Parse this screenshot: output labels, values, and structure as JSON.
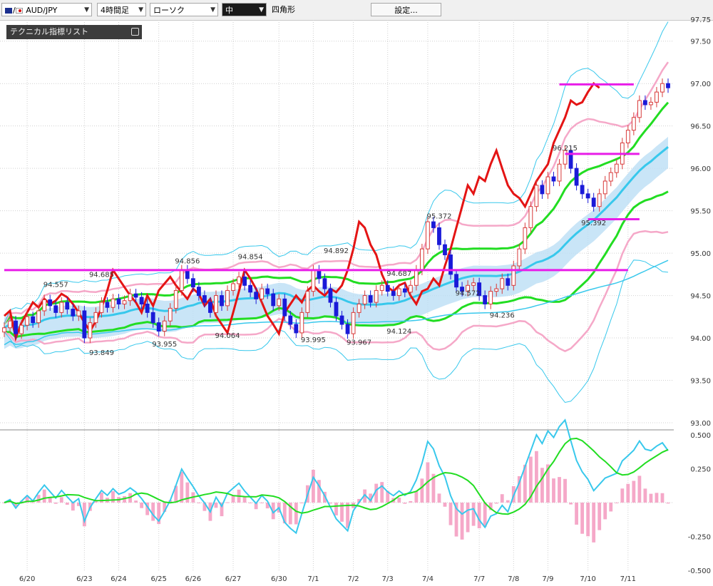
{
  "toolbar": {
    "symbol": "AUD/JPY",
    "timeframe": "4時間足",
    "chart_type": "ローソク",
    "line_width": "中",
    "draw_tool": "四角形",
    "settings": "設定..."
  },
  "indicator_panel": {
    "title": "テクニカル指標リスト"
  },
  "colors": {
    "bull": "#d83a3a",
    "bear": "#1a1ad8",
    "red_line": "#e41414",
    "green": "#22dd22",
    "pink": "#f5a8c8",
    "magenta": "#e81ce8",
    "cyan": "#38c8ec",
    "cloud": "#bcdff5"
  },
  "chart_data": {
    "type": "candlestick",
    "ylim": [
      93.0,
      97.75
    ],
    "y_ticks": [
      "97.50",
      "97.00",
      "96.50",
      "96.00",
      "95.50",
      "95.00",
      "94.50",
      "94.00",
      "93.50",
      "93.00"
    ],
    "y_top_partial": "97.75",
    "date_labels": [
      {
        "label": "6/20",
        "i": 4
      },
      {
        "label": "6/23",
        "i": 14
      },
      {
        "label": "6/24",
        "i": 20
      },
      {
        "label": "6/25",
        "i": 27
      },
      {
        "label": "6/26",
        "i": 33
      },
      {
        "label": "6/27",
        "i": 40
      },
      {
        "label": "6/30",
        "i": 48
      },
      {
        "label": "7/1",
        "i": 54
      },
      {
        "label": "7/2",
        "i": 61
      },
      {
        "label": "7/3",
        "i": 67
      },
      {
        "label": "7/4",
        "i": 74
      },
      {
        "label": "7/7",
        "i": 83
      },
      {
        "label": "7/8",
        "i": 89
      },
      {
        "label": "7/9",
        "i": 95
      },
      {
        "label": "7/10",
        "i": 102
      },
      {
        "label": "7/11",
        "i": 109
      }
    ],
    "candles_close": [
      94.12,
      94.2,
      94.05,
      94.15,
      94.25,
      94.18,
      94.32,
      94.45,
      94.38,
      94.3,
      94.42,
      94.34,
      94.26,
      94.32,
      94.0,
      94.18,
      94.3,
      94.42,
      94.36,
      94.46,
      94.4,
      94.44,
      94.52,
      94.48,
      94.4,
      94.3,
      94.18,
      94.08,
      94.2,
      94.35,
      94.56,
      94.8,
      94.7,
      94.6,
      94.5,
      94.42,
      94.3,
      94.5,
      94.38,
      94.56,
      94.64,
      94.72,
      94.62,
      94.54,
      94.46,
      94.58,
      94.52,
      94.38,
      94.46,
      94.26,
      94.16,
      94.06,
      94.3,
      94.55,
      94.8,
      94.7,
      94.58,
      94.42,
      94.26,
      94.16,
      94.05,
      94.3,
      94.4,
      94.5,
      94.42,
      94.56,
      94.62,
      94.55,
      94.5,
      94.58,
      94.54,
      94.62,
      94.8,
      95.05,
      95.37,
      95.3,
      95.1,
      94.98,
      94.75,
      94.6,
      94.55,
      94.62,
      94.65,
      94.5,
      94.4,
      94.55,
      94.58,
      94.7,
      94.62,
      94.85,
      95.05,
      95.3,
      95.55,
      95.8,
      95.7,
      95.9,
      95.85,
      96.05,
      96.21,
      96.0,
      95.8,
      95.7,
      95.65,
      95.55,
      95.7,
      95.85,
      95.95,
      96.05,
      96.3,
      96.45,
      96.6,
      96.8,
      96.75,
      96.78,
      96.9,
      97.0,
      96.95
    ],
    "price_labels": [
      {
        "text": "94.557",
        "i": 9,
        "y": 94.6
      },
      {
        "text": "94.685",
        "i": 17,
        "y": 94.72
      },
      {
        "text": "94.856",
        "i": 32,
        "y": 94.88
      },
      {
        "text": "94.854",
        "i": 43,
        "y": 94.93
      },
      {
        "text": "94.892",
        "i": 58,
        "y": 95.0
      },
      {
        "text": "94.687",
        "i": 69,
        "y": 94.73
      },
      {
        "text": "95.372",
        "i": 76,
        "y": 95.41
      },
      {
        "text": "94.572",
        "i": 81,
        "y": 94.5
      },
      {
        "text": "96.215",
        "i": 98,
        "y": 96.21
      },
      {
        "text": "93.849",
        "i": 17,
        "y": 93.8
      },
      {
        "text": "93.955",
        "i": 28,
        "y": 93.9
      },
      {
        "text": "94.064",
        "i": 39,
        "y": 94.0
      },
      {
        "text": "93.995",
        "i": 54,
        "y": 93.95
      },
      {
        "text": "93.967",
        "i": 62,
        "y": 93.92
      },
      {
        "text": "94.124",
        "i": 69,
        "y": 94.05
      },
      {
        "text": "94.236",
        "i": 87,
        "y": 94.24
      },
      {
        "text": "95.392",
        "i": 103,
        "y": 95.33
      }
    ],
    "hlines": [
      {
        "y": 94.8,
        "from": 0,
        "to": 109,
        "color": "magenta"
      },
      {
        "y": 95.4,
        "from": 102,
        "to": 111,
        "color": "magenta"
      },
      {
        "y": 96.17,
        "from": 98,
        "to": 111,
        "color": "magenta"
      },
      {
        "y": 96.99,
        "from": 97,
        "to": 110,
        "color": "magenta"
      }
    ],
    "osc": {
      "ylim": [
        -0.5,
        0.5
      ],
      "y_ticks": [
        "0.500",
        "0.250",
        "-0.250",
        "-0.500"
      ]
    }
  }
}
